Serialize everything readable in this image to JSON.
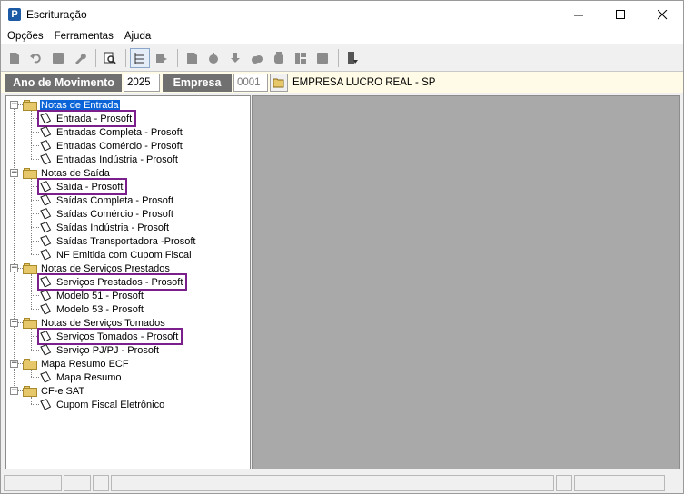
{
  "window": {
    "title": "Escrituração",
    "controls": {
      "minimize": "—",
      "maximize": "☐",
      "close": "✕"
    }
  },
  "menu": [
    "Opções",
    "Ferramentas",
    "Ajuda"
  ],
  "filter": {
    "ano_label": "Ano de Movimento",
    "ano_value": "2025",
    "empresa_label": "Empresa",
    "empresa_code": "0001",
    "empresa_name": "EMPRESA LUCRO REAL - SP"
  },
  "tree": {
    "groups": [
      {
        "label": "Notas de Entrada",
        "children": [
          "Entrada - Prosoft",
          "Entradas Completa - Prosoft",
          "Entradas Comércio - Prosoft",
          "Entradas Indústria - Prosoft"
        ]
      },
      {
        "label": "Notas de Saída",
        "children": [
          "Saída - Prosoft",
          "Saídas Completa - Prosoft",
          "Saídas Comércio - Prosoft",
          "Saídas Indústria - Prosoft",
          "Saídas Transportadora -Prosoft",
          "NF Emitida com Cupom Fiscal"
        ]
      },
      {
        "label": "Notas de Serviços Prestados",
        "children": [
          "Serviços Prestados - Prosoft",
          "Modelo 51 - Prosoft",
          "Modelo 53 - Prosoft"
        ]
      },
      {
        "label": "Notas de Serviços Tomados",
        "children": [
          "Serviços Tomados - Prosoft",
          "Serviço PJ/PJ - Prosoft"
        ]
      },
      {
        "label": "Mapa Resumo ECF",
        "children": [
          "Mapa Resumo"
        ]
      },
      {
        "label": "CF-e SAT",
        "children": [
          "Cupom Fiscal Eletrônico"
        ]
      }
    ]
  },
  "colors": {
    "selection": "#0a64d8",
    "highlight": "#7a1f8c",
    "right_pane": "#a9a9a9",
    "filter_bg": "#fffbe6"
  }
}
